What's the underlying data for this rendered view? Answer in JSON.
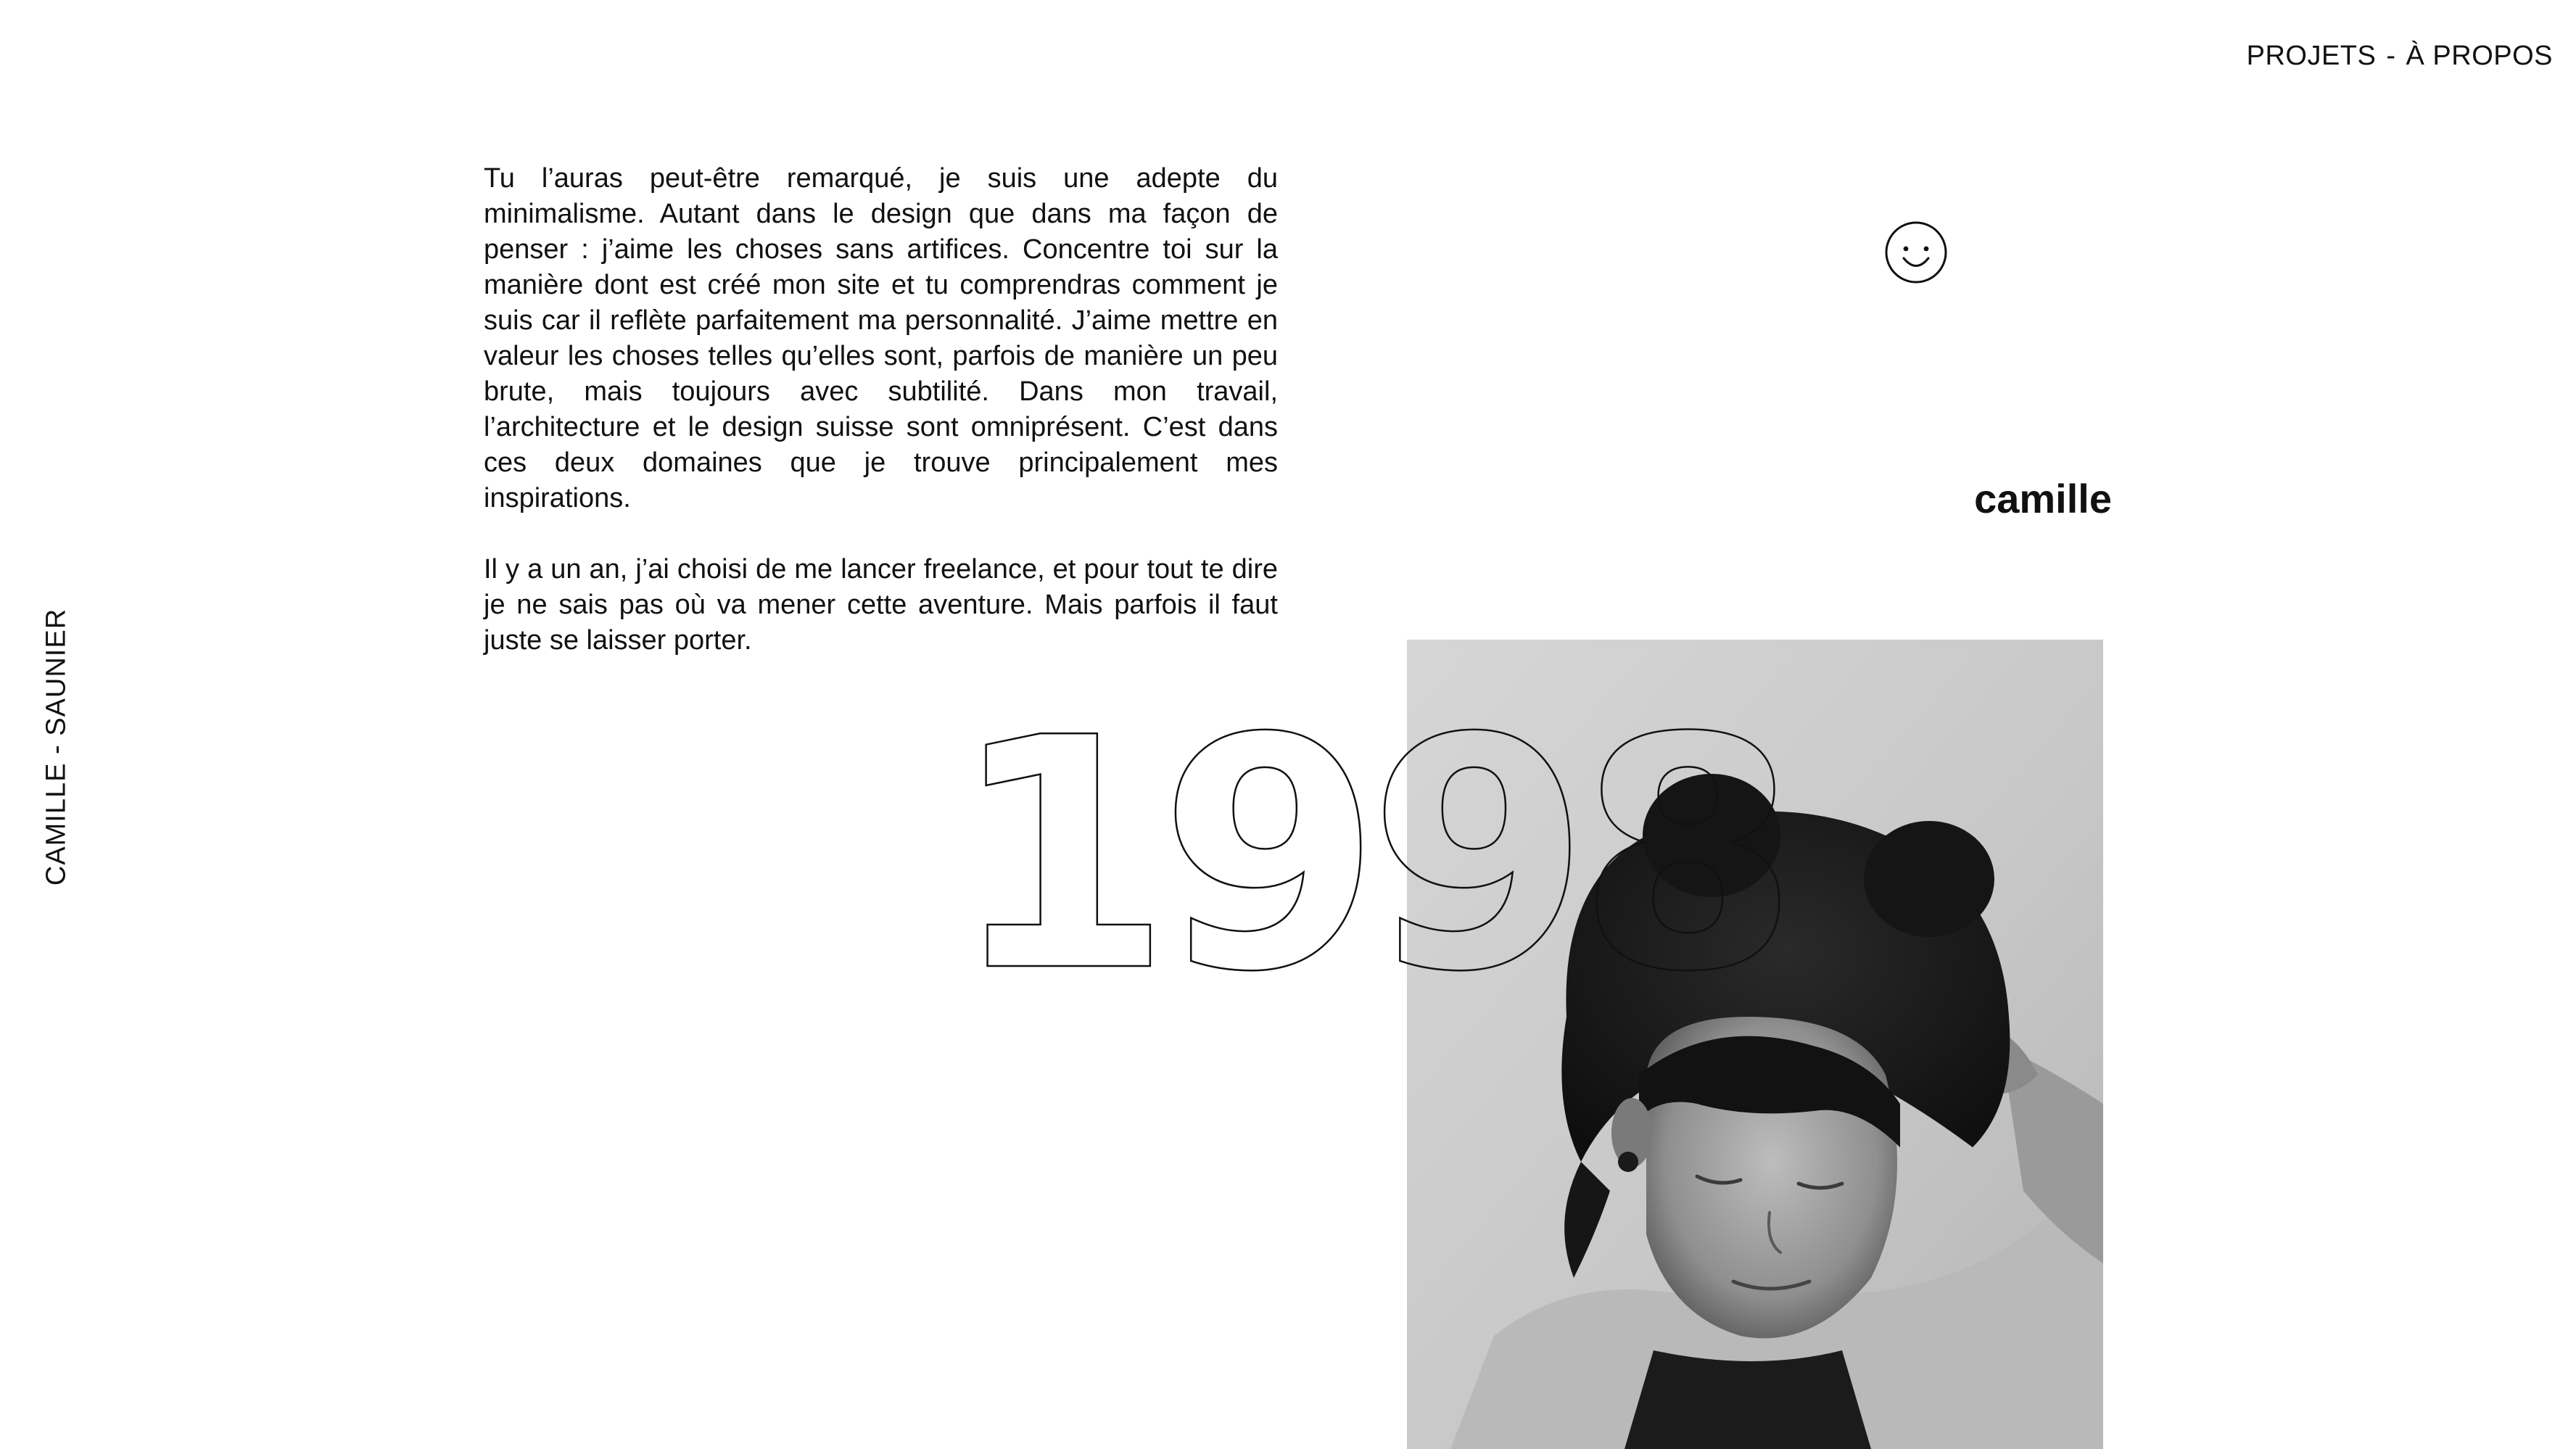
{
  "nav": {
    "projects": "PROJETS",
    "separator": "-",
    "about": "À PROPOS"
  },
  "side": {
    "name": "CAMILLE - SAUNIER"
  },
  "about": {
    "paragraph1": "Tu l’auras peut-être remarqué, je suis une adepte du minimalisme. Autant dans le design que dans ma façon de penser : j’aime les choses sans artifices. Concentre toi sur la manière dont est créé mon site et tu comprendras comment je suis car il reflète parfaitement ma personnalité. J’aime mettre en valeur les choses telles qu’elles sont, parfois de manière un peu brute, mais toujours avec subtilité. Dans mon travail, l’architecture et le design suisse sont omniprésent. C’est dans ces deux domaines que je trouve principalement mes inspirations.",
    "paragraph2": "Il y a un an, j’ai choisi de me lancer freelance, et pour tout te dire je ne sais pas où va mener cette aventure. Mais parfois il faut juste se laisser porter.",
    "year": "1998",
    "first_name": "camille"
  },
  "icons": {
    "smiley": "smiley-face-icon",
    "portrait": "portrait-photo"
  },
  "colors": {
    "text": "#111111",
    "background": "#ffffff"
  }
}
